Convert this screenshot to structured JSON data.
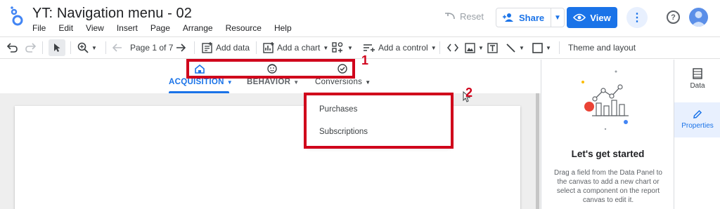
{
  "app": {
    "title": "YT: Navigation menu - 02",
    "menu": [
      "File",
      "Edit",
      "View",
      "Insert",
      "Page",
      "Arrange",
      "Resource",
      "Help"
    ],
    "reset_label": "Reset",
    "share_label": "Share",
    "view_label": "View"
  },
  "toolbar": {
    "page_indicator": "Page 1 of 7",
    "add_data": "Add data",
    "add_chart": "Add a chart",
    "add_control": "Add a control",
    "theme_layout": "Theme and layout"
  },
  "nav": {
    "tabs": [
      {
        "label": "ACQUISITION",
        "active": true
      },
      {
        "label": "BEHAVIOR",
        "active": false
      },
      {
        "label": "Conversions",
        "active": false
      }
    ],
    "icons": [
      "home-icon",
      "face-icon",
      "check-circle-icon"
    ],
    "dropdown_items": [
      "Purchases",
      "Subscriptions"
    ]
  },
  "annotations": {
    "marker_1": "1",
    "marker_2": "2",
    "color": "#d0021b"
  },
  "right_panel": {
    "title": "Let's get started",
    "description": "Drag a field from the Data Panel to the canvas to add a new chart or select a component on the report canvas to edit it.",
    "side_tabs": [
      {
        "label": "Data",
        "active": false
      },
      {
        "label": "Properties",
        "active": true
      }
    ]
  },
  "colors": {
    "accent": "#1a73e8",
    "annotation_red": "#d0021b"
  }
}
